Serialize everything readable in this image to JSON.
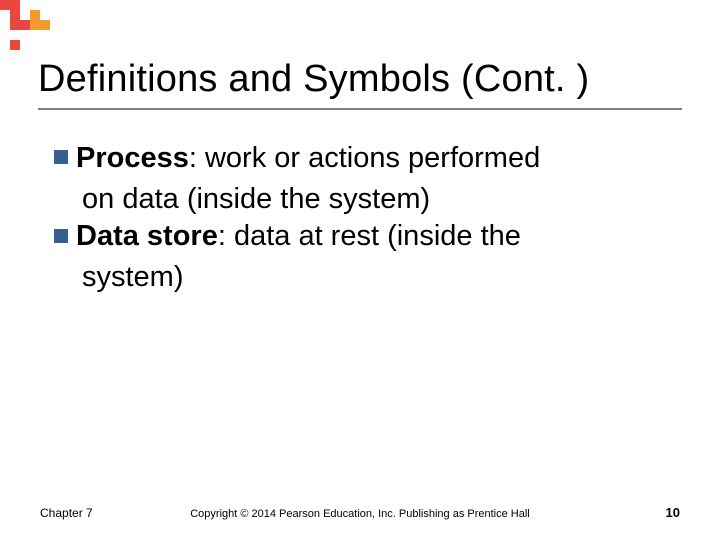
{
  "logo": {
    "pixels": [
      [
        "#e9473f",
        "#e9473f",
        "",
        "",
        ""
      ],
      [
        "",
        "#e9473f",
        "",
        "#f39b2e",
        ""
      ],
      [
        "",
        "#e9473f",
        "#e9473f",
        "#f39b2e",
        "#f39b2e"
      ],
      [
        "",
        "",
        "",
        "",
        ""
      ],
      [
        "",
        "#e9473f",
        "",
        "",
        ""
      ]
    ]
  },
  "title": "Definitions and Symbols (Cont. )",
  "bullets": [
    {
      "term": "Process",
      "text_after_term": ": work or actions performed",
      "continuation": "on data (inside the system)"
    },
    {
      "term": "Data store",
      "text_after_term": ": data at rest (inside the",
      "continuation": "system)"
    }
  ],
  "footer": {
    "left": "Chapter 7",
    "center": "Copyright © 2014 Pearson Education, Inc. Publishing as Prentice Hall",
    "right": "10"
  }
}
